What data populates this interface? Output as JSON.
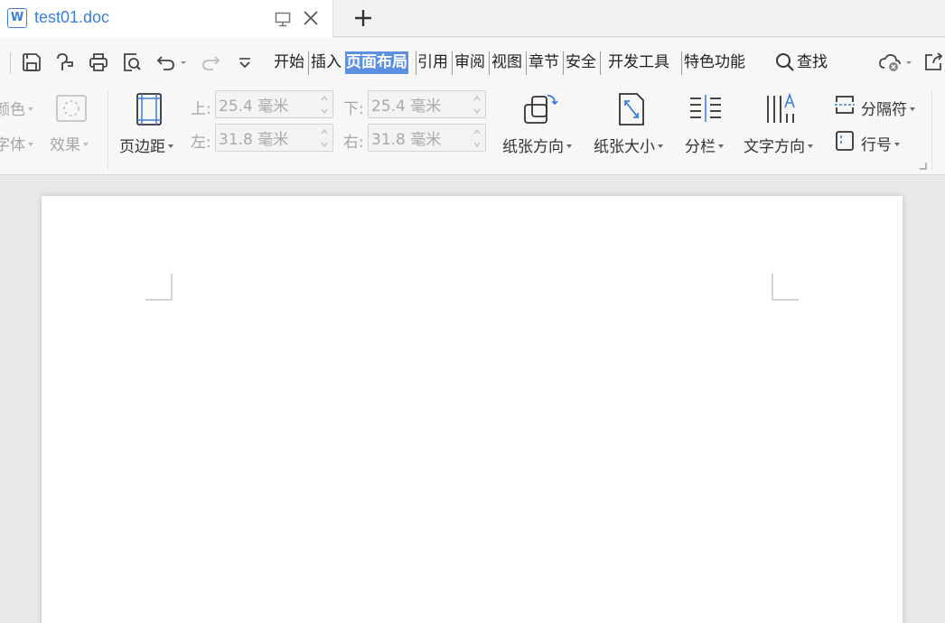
{
  "tab": {
    "doc_icon_letter": "W",
    "title": "test01.doc"
  },
  "menu": {
    "items": [
      "开始",
      "插入",
      "页面布局",
      "引用",
      "审阅",
      "视图",
      "章节",
      "安全",
      "开发工具",
      "特色功能"
    ],
    "active": "页面布局",
    "search_label": "查找"
  },
  "ribbon": {
    "left_cut": {
      "color_label": "颜色",
      "font_label": "字体",
      "effect_label": "效果"
    },
    "margins_label": "页边距",
    "top_label": "上:",
    "top_value": "25.4 毫米",
    "bottom_label": "下:",
    "bottom_value": "25.4 毫米",
    "left_label": "左:",
    "left_value": "31.8 毫米",
    "right_label": "右:",
    "right_value": "31.8 毫米",
    "orientation_label": "纸张方向",
    "size_label": "纸张大小",
    "columns_label": "分栏",
    "text_direction_label": "文字方向",
    "separator_label": "分隔符",
    "line_number_label": "行号"
  },
  "colors": {
    "accent": "#5b8fe0",
    "tab_text": "#3b7fd8",
    "page": "#ffffff",
    "workspace": "#e8e8e8"
  }
}
